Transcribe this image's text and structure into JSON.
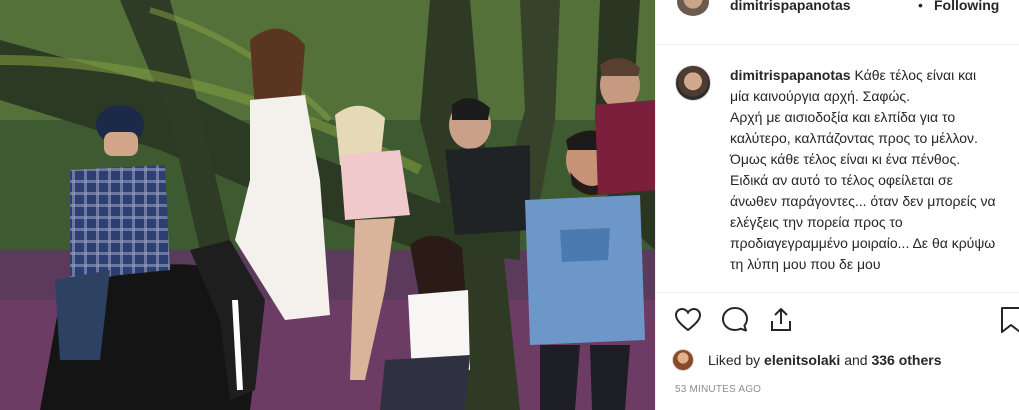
{
  "post": {
    "author": "dimitrispapanotas",
    "separator": "•",
    "follow_status": "Following",
    "caption": "Κάθε τέλος είναι και μία καινούργια αρχή. Σαφώς.\nΑρχή με αισιοδοξία και ελπίδα για το καλύτερο, καλπάζοντας προς το μέλλον.\nΌμως κάθε τέλος είναι κι ένα πένθος. Ειδικά αν αυτό το τέλος οφείλεται σε άνωθεν παράγοντες... όταν δεν μπορείς να ελέγξεις την πορεία προς το προδιαγεγραμμένο μοιραίο... Δε θα κρύψω τη λύπη μου που δε μου",
    "liked_by_prefix": "Liked by ",
    "liked_by_user": "elenitsolaki",
    "liked_by_middle": " and ",
    "liked_by_others": "336 others",
    "timestamp": "53 MINUTES AGO"
  },
  "icons": {
    "like": "heart-icon",
    "comment": "comment-icon",
    "share": "share-icon",
    "save": "bookmark-icon"
  },
  "photo": {
    "description_icon": "group-photo-in-forest"
  }
}
